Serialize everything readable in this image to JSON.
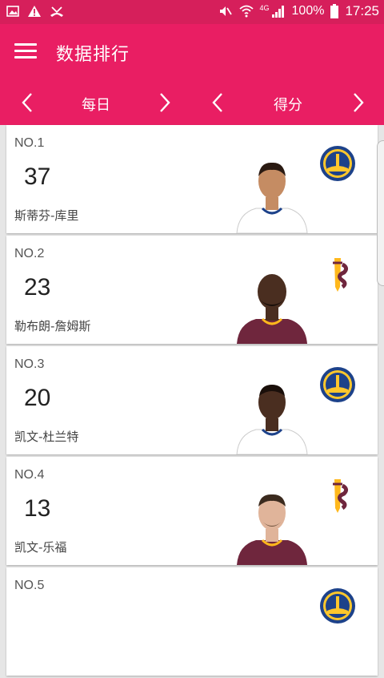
{
  "status": {
    "signal_label": "4G",
    "battery": "100%",
    "time": "17:25"
  },
  "header": {
    "title": "数据排行"
  },
  "filters": {
    "period": "每日",
    "stat": "得分"
  },
  "players": [
    {
      "rank": "NO.1",
      "score": "37",
      "name": "斯蒂芬-库里",
      "team": "warriors",
      "jersey": "#ffffff"
    },
    {
      "rank": "NO.2",
      "score": "23",
      "name": "勒布朗-詹姆斯",
      "team": "cavaliers",
      "jersey": "#6f263d"
    },
    {
      "rank": "NO.3",
      "score": "20",
      "name": "凯文-杜兰特",
      "team": "warriors",
      "jersey": "#ffffff"
    },
    {
      "rank": "NO.4",
      "score": "13",
      "name": "凯文-乐福",
      "team": "cavaliers",
      "jersey": "#6f263d"
    },
    {
      "rank": "NO.5",
      "score": "",
      "name": "",
      "team": "warriors",
      "jersey": "#ffffff"
    }
  ],
  "colors": {
    "accent": "#e91e63",
    "status_bar": "#d61f5b",
    "warriors_blue": "#1d428a",
    "warriors_gold": "#ffc72c",
    "cavs_wine": "#6f263d",
    "cavs_gold": "#ffb81c"
  }
}
